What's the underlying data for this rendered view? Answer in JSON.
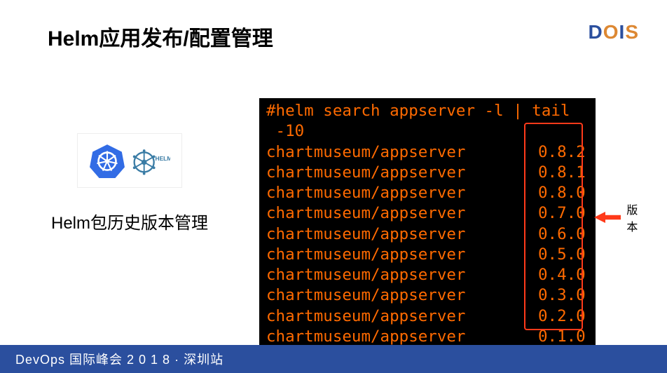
{
  "header": {
    "title": "Helm应用发布/配置管理",
    "brand": {
      "d": "D",
      "o": "O",
      "i": "I",
      "s": "S"
    }
  },
  "left": {
    "helm_label": "HELM",
    "caption": "Helm包历史版本管理"
  },
  "terminal": {
    "command_prefix": "# ",
    "command": "helm search appserver -l | tail -10",
    "rows": [
      {
        "name": "chartmuseum/appserver",
        "version": "0.8.2"
      },
      {
        "name": "chartmuseum/appserver",
        "version": "0.8.1"
      },
      {
        "name": "chartmuseum/appserver",
        "version": "0.8.0"
      },
      {
        "name": "chartmuseum/appserver",
        "version": "0.7.0"
      },
      {
        "name": "chartmuseum/appserver",
        "version": "0.6.0"
      },
      {
        "name": "chartmuseum/appserver",
        "version": "0.5.0"
      },
      {
        "name": "chartmuseum/appserver",
        "version": "0.4.0"
      },
      {
        "name": "chartmuseum/appserver",
        "version": "0.3.0"
      },
      {
        "name": "chartmuseum/appserver",
        "version": "0.2.0"
      },
      {
        "name": "chartmuseum/appserver",
        "version": "0.1.0"
      }
    ]
  },
  "annotation": {
    "arrow_label": "版本"
  },
  "footer": {
    "text": "DevOps 国际峰会 2 0 1 8 · 深圳站"
  }
}
